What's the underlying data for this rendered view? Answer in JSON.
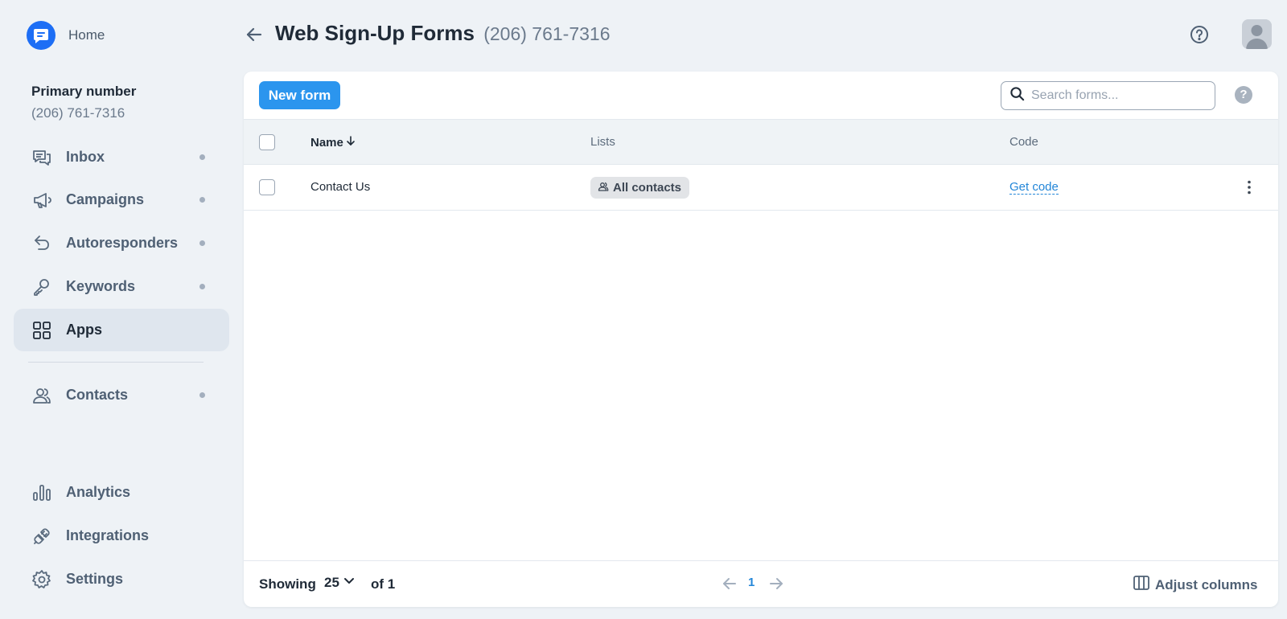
{
  "sidebar": {
    "home_label": "Home",
    "primary_title": "Primary number",
    "primary_number": "(206) 761-7316",
    "items": [
      {
        "label": "Inbox",
        "icon": "chat-bubbles-icon"
      },
      {
        "label": "Campaigns",
        "icon": "megaphone-icon"
      },
      {
        "label": "Autoresponders",
        "icon": "reply-arrow-icon"
      },
      {
        "label": "Keywords",
        "icon": "key-icon"
      },
      {
        "label": "Apps",
        "icon": "grid-icon",
        "active": true
      },
      {
        "label": "Contacts",
        "icon": "contacts-icon"
      },
      {
        "label": "Analytics",
        "icon": "bar-chart-icon"
      },
      {
        "label": "Integrations",
        "icon": "plug-icon"
      },
      {
        "label": "Settings",
        "icon": "gear-icon"
      }
    ]
  },
  "header": {
    "title": "Web Sign-Up Forms",
    "subtitle": "(206) 761-7316"
  },
  "toolbar": {
    "new_form_label": "New form",
    "search_placeholder": "Search forms..."
  },
  "table": {
    "columns": {
      "name": "Name",
      "lists": "Lists",
      "code": "Code"
    },
    "rows": [
      {
        "name": "Contact Us",
        "list": "All contacts",
        "code_link": "Get code"
      }
    ]
  },
  "footer": {
    "showing": "Showing",
    "page_size": "25",
    "of": "of 1",
    "current_page": "1",
    "adjust_columns": "Adjust columns"
  },
  "colors": {
    "accent": "#2b95ee",
    "brand": "#1d6ef5",
    "link": "#2386d8",
    "background": "#eef2f6"
  }
}
